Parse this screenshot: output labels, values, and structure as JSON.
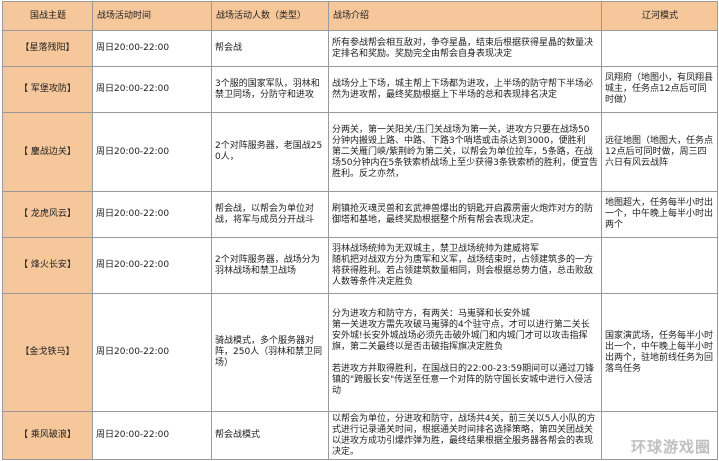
{
  "headers": [
    "国战主题",
    "战场活动时间",
    "战场活动人数（类型）",
    "战场介绍",
    "辽河模式"
  ],
  "rows": [
    {
      "theme": "【星落残阳】",
      "time": "周日20:00-22:00",
      "count": "帮会战",
      "intro": "所有参战帮会相互敌对，争夺星晶，结束后根据获得星晶的数量决定排名和奖励。奖励完全由帮会自身表现决定",
      "mode": ""
    },
    {
      "theme": "【 军堡攻防】",
      "time": "周日20:00-22:00",
      "count": "3个服的国家军队，羽林和禁卫同场，分防守和进攻",
      "intro": "战场分上下场，城主帮上下场都为进攻，上半场的防守帮下半场必然为进攻帮，最终奖励根据上下半场的总和表现排名决定",
      "mode": "凤翔府（地图小，有凤翔县城主，任务点12点后可同时做）"
    },
    {
      "theme": "【 鏖战边关】",
      "time": "周日20:00-22:00",
      "count": "2个对阵服务器，老国战250人，",
      "intro": "分两关，第一关阳关/玉门关战场为第一关，进攻方只要在战场50分钟内搬毁上路、中路、下路3个哨塔或击杀达到3000，便胜利\n第二关雁门峡/紫荆岭为第二关，以帮会为单位拉车，5条路，在战场50分钟内在5条铁索桥战场上至少获得3条铁索桥的胜利，便宣告胜利。反之亦然，",
      "mode": "远征地图（地图大，任务点12点后可同时做，周三四六日有风云战阵"
    },
    {
      "theme": "【 龙虎风云】",
      "time": "周日20:00-22:00",
      "count": "帮会战，以帮会为单位对战，将军与成员分开战斗",
      "intro": "刷镇抢灭魂灵兽和玄武神兽爆出的钥匙开启霹雳雷火炮炸对方的防御塔和基地，最终奖励根据整个所有帮会表现决定。",
      "mode": "地图超大，任务每半小时出一个，中午晚上每半小时出两个"
    },
    {
      "theme": "【 烽火长安】",
      "time": "周日20:00-22:00",
      "count": "2个对阵服务器，战场分为羽林战场和禁卫战场",
      "intro": "羽林战场统帅为无双城主，禁卫战场统帅为建威将军\n随机把对战双方分为唐军和义军，战场结束时，占领建筑多的一方将获得胜利。若占领建筑数量相同，则会根据总势力值，总击败敌人数等条件决定胜负",
      "mode": ""
    },
    {
      "theme": "【金戈铁马】",
      "time": "周日20:00-22:00",
      "count": "骑战模式，多个服务器对阵，250人（羽林和禁卫同场）",
      "intro": "分为进攻方和防守方，有两关：马嵬驿和长安外城\n第一关进攻方需先攻破马嵬驿的4个驻守点，才可以进行第二关长安外城!长安外城战场必须先击破外城门和内城门才可以攻击指挥旗，第二关最终以是否击破指挥旗决定胜负\n\n若进攻方并取得胜利，在国战日的22:00-23:59期间可以通过刀锋镇的\"跨服长安\"传送至任意一个对阵的防守国长安城中进行入侵活动",
      "mode": "国家演武场，任务每半小时出一个，中午晚上每半小时出两个，驻地前线任务为回落鸟任务"
    },
    {
      "theme": "【 乘风破浪】",
      "time": "周日20:00-22:00",
      "count": "帮会战模式",
      "intro": "以帮会为单位，分进攻和防守，战场共4关，前三关以5人小队的方式进行记录通关时间，根据通关时间排名选择策略，第四关团战关以进攻方成功引爆炸弹为胜，最终结果根据全服务器各帮会的表现决定。",
      "mode": ""
    }
  ],
  "watermark": "环球游戏圈"
}
